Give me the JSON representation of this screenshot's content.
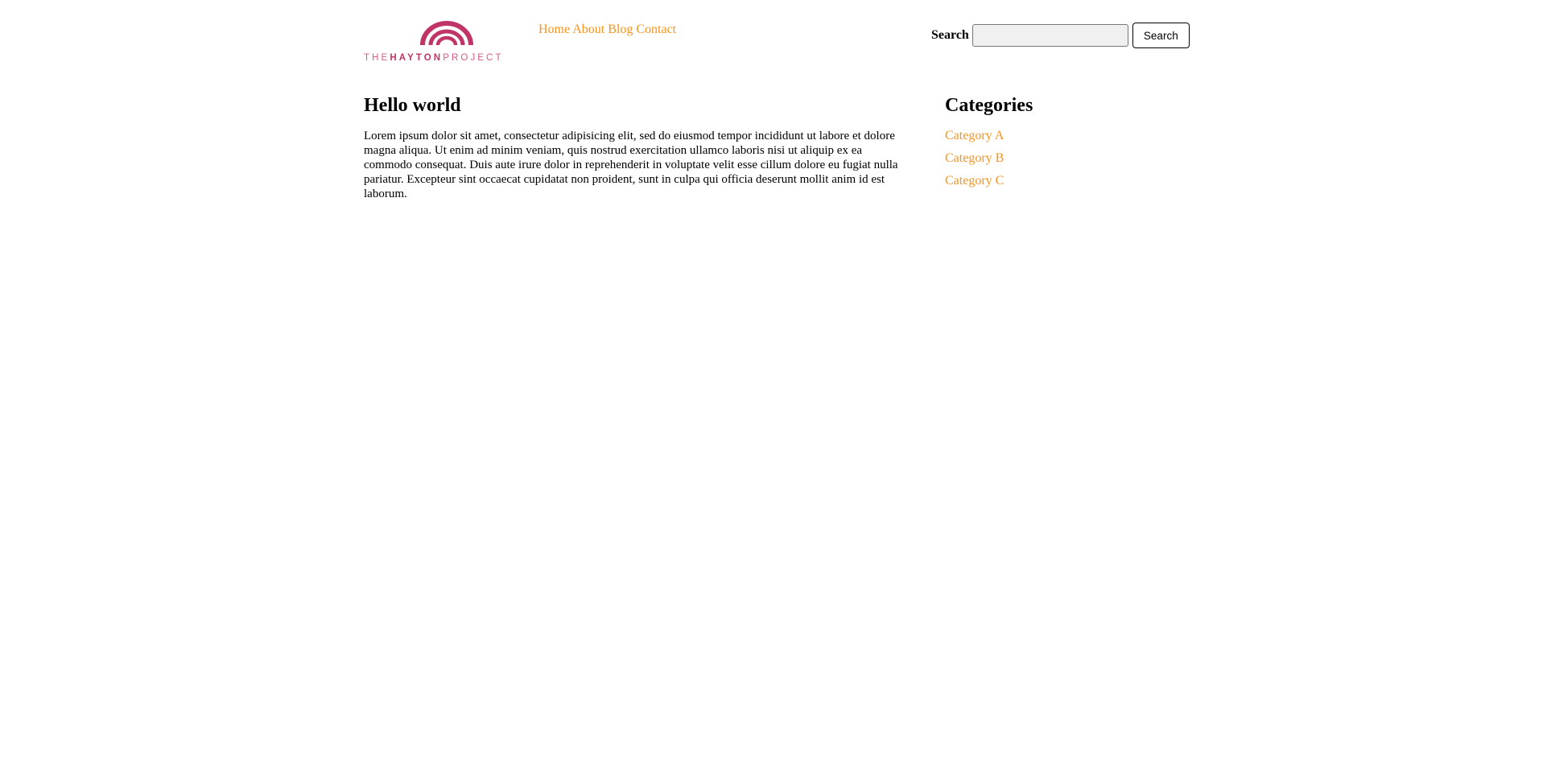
{
  "brand": {
    "logo_text_prefix": "THE",
    "logo_text_bold": "HAYTON",
    "logo_text_suffix": "PROJECT",
    "color": "#c03468"
  },
  "nav": {
    "items": [
      {
        "label": "Home"
      },
      {
        "label": "About"
      },
      {
        "label": "Blog"
      },
      {
        "label": "Contact"
      }
    ],
    "link_color": "#f7931e"
  },
  "search": {
    "label": "Search",
    "value": "",
    "button_label": "Search"
  },
  "main": {
    "title": "Hello world",
    "body": "Lorem ipsum dolor sit amet, consectetur adipisicing elit, sed do eiusmod tempor incididunt ut labore et dolore magna aliqua. Ut enim ad minim veniam, quis nostrud exercitation ullamco laboris nisi ut aliquip ex ea commodo consequat. Duis aute irure dolor in reprehenderit in voluptate velit esse cillum dolore eu fugiat nulla pariatur. Excepteur sint occaecat cupidatat non proident, sunt in culpa qui officia deserunt mollit anim id est laborum."
  },
  "sidebar": {
    "title": "Categories",
    "items": [
      {
        "label": "Category A"
      },
      {
        "label": "Category B"
      },
      {
        "label": "Category C"
      }
    ]
  }
}
